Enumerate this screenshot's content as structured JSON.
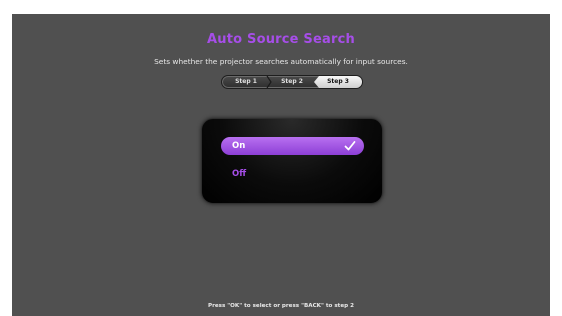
{
  "header": {
    "title": "Auto Source Search",
    "description": "Sets whether the projector searches automatically for input sources."
  },
  "steps": {
    "items": [
      {
        "label": "Step 1"
      },
      {
        "label": "Step 2"
      },
      {
        "label": "Step 3"
      }
    ],
    "active_index": 2
  },
  "options": {
    "items": [
      {
        "label": "On",
        "selected": true
      },
      {
        "label": "Off",
        "selected": false
      }
    ],
    "selected_icon": "checkmark-icon"
  },
  "footer": {
    "hint": "Press \"OK\" to select or press \"BACK\" to step 2"
  },
  "colors": {
    "background": "#505050",
    "accent": "#a64ee8",
    "highlight": "#9c52e2"
  }
}
